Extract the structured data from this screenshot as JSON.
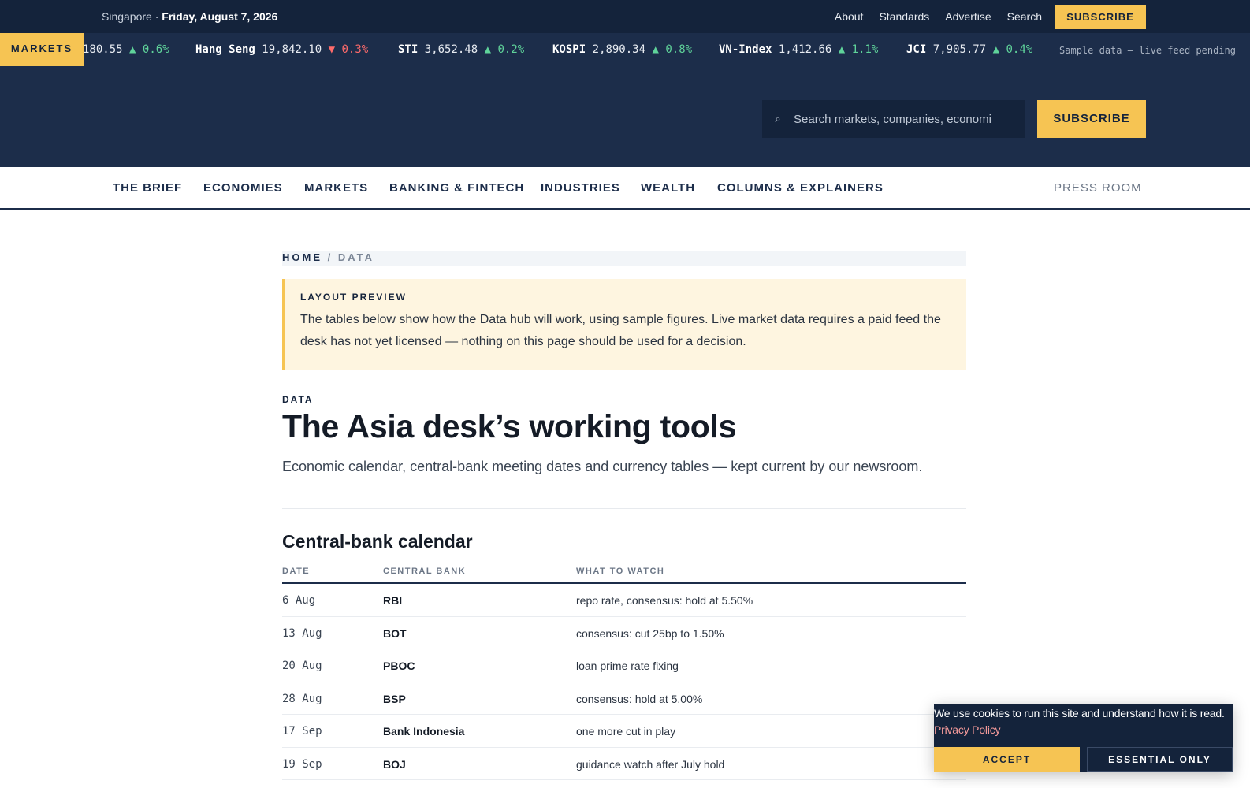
{
  "topbar": {
    "location": "Singapore",
    "separator": " · ",
    "date": "Friday, August 7, 2026",
    "links": [
      "About",
      "Standards",
      "Advertise",
      "Search"
    ],
    "subscribe_label": "SUBSCRIBE"
  },
  "ticker": {
    "label": "MARKETS",
    "items": [
      {
        "name": "",
        "value": "180.55",
        "dir": "▲",
        "change": "0.6%",
        "trend": "up"
      },
      {
        "name": "Hang Seng",
        "value": "19,842.10",
        "dir": "▼",
        "change": "0.3%",
        "trend": "down"
      },
      {
        "name": "STI",
        "value": "3,652.48",
        "dir": "▲",
        "change": "0.2%",
        "trend": "up"
      },
      {
        "name": "KOSPI",
        "value": "2,890.34",
        "dir": "▲",
        "change": "0.8%",
        "trend": "up"
      },
      {
        "name": "VN-Index",
        "value": "1,412.66",
        "dir": "▲",
        "change": "1.1%",
        "trend": "up"
      },
      {
        "name": "JCI",
        "value": "7,905.77",
        "dir": "▲",
        "change": "0.4%",
        "trend": "up"
      }
    ],
    "note": "Sample data — live feed pending"
  },
  "masthead": {
    "search_icon": "search-icon",
    "search_placeholder": "Search markets, companies, economi",
    "subscribe_label": "SUBSCRIBE"
  },
  "nav": {
    "items": [
      "THE BRIEF",
      "ECONOMIES",
      "MARKETS",
      "BANKING & FINTECH",
      "INDUSTRIES",
      "WEALTH",
      "COLUMNS & EXPLAINERS"
    ],
    "press_room": "PRESS ROOM"
  },
  "breadcrumb": {
    "home": "HOME",
    "separator": "/",
    "current": "DATA"
  },
  "preview": {
    "label": "LAYOUT PREVIEW",
    "text": "The tables below show how the Data hub will work, using sample figures. Live market data requires a paid feed the desk has not yet licensed — nothing on this page should be used for a decision."
  },
  "page": {
    "kicker": "DATA",
    "title": "The Asia desk’s working tools",
    "dek": "Economic calendar, central-bank meeting dates and currency tables — kept current by our newsroom."
  },
  "calendar": {
    "heading": "Central-bank calendar",
    "columns": [
      "DATE",
      "CENTRAL BANK",
      "WHAT TO WATCH"
    ],
    "rows": [
      {
        "date": "6 Aug",
        "bank": "RBI",
        "watch": "repo rate, consensus: hold at 5.50%"
      },
      {
        "date": "13 Aug",
        "bank": "BOT",
        "watch": "consensus: cut 25bp to 1.50%"
      },
      {
        "date": "20 Aug",
        "bank": "PBOC",
        "watch": "loan prime rate fixing"
      },
      {
        "date": "28 Aug",
        "bank": "BSP",
        "watch": "consensus: hold at 5.00%"
      },
      {
        "date": "17 Sep",
        "bank": "Bank Indonesia",
        "watch": "one more cut in play"
      },
      {
        "date": "19 Sep",
        "bank": "BOJ",
        "watch": "guidance watch after July hold"
      }
    ]
  },
  "cookie": {
    "message": "We use cookies to run this site and understand how it is read.",
    "policy_link": "Privacy Policy",
    "accept_label": "ACCEPT",
    "essential_label": "ESSENTIAL ONLY"
  },
  "colors": {
    "navy_dark": "#14233b",
    "navy": "#1c2d4a",
    "accent_yellow": "#f6c453",
    "up_green": "#5fd39a",
    "down_red": "#ff6b6b",
    "preview_bg": "#fef5e0"
  }
}
